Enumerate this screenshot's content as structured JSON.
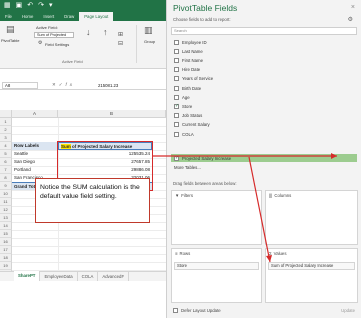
{
  "ribbon": {
    "tabs": [
      "File",
      "Home",
      "Insert",
      "Draw",
      "Page Layout"
    ],
    "active_tab": "Page Layout",
    "active_field_label": "Active Field:",
    "active_field_value": "Sum of Projected",
    "field_settings": "Field Settings",
    "pivottable_label": "PivotTable",
    "group_label": "Active Field",
    "group_btn": "Group"
  },
  "formula_bar": {
    "name_box": "A8",
    "fx": "fx",
    "value": "215081.23"
  },
  "grid": {
    "col_headers": [
      "A",
      "B"
    ],
    "row_numbers": [
      "1",
      "2",
      "3",
      "4",
      "5",
      "6",
      "7",
      "8",
      "9",
      "10",
      "11",
      "12",
      "13",
      "14",
      "15",
      "16",
      "17",
      "18",
      "19",
      "20",
      "21",
      "22",
      "23"
    ],
    "pivot": {
      "row_labels_header": "Row Labels",
      "value_header_sum": "Sum",
      "value_header_rest": " of Projected Salary Increase",
      "rows": [
        {
          "label": "Seattle",
          "value": "125535.24"
        },
        {
          "label": "San Diego",
          "value": "27657.85"
        },
        {
          "label": "Portland",
          "value": "29886.08"
        },
        {
          "label": "San Francisco",
          "value": "32031.06"
        }
      ],
      "grand_total_label": "Grand Total",
      "grand_total_value": "215081.23"
    }
  },
  "note": "Notice the SUM calculation is the default value field setting.",
  "sheet_tabs": [
    "SharePT",
    "EmployeeData",
    "COLA",
    "AdvancedF"
  ],
  "pane": {
    "title": "PivotTable Fields",
    "close": "×",
    "subtitle": "Choose fields to add to report:",
    "search_placeholder": "Search",
    "fields": [
      {
        "name": "Employee ID",
        "checked": false
      },
      {
        "name": "Last Name",
        "checked": false
      },
      {
        "name": "First Name",
        "checked": false
      },
      {
        "name": "Hire Date",
        "checked": false
      },
      {
        "name": "Years of Service",
        "checked": false
      },
      {
        "name": "Birth Date",
        "checked": false
      },
      {
        "name": "Age",
        "checked": false
      },
      {
        "name": "Store",
        "checked": true
      },
      {
        "name": "Job Status",
        "checked": false
      },
      {
        "name": "Current Salary",
        "checked": false
      },
      {
        "name": "COLA",
        "checked": false
      },
      {
        "name": "Projected Salary Increase",
        "checked": true
      }
    ],
    "more_tables": "More Tables...",
    "drag_label": "Drag fields between areas below:",
    "areas": {
      "filters": "Filters",
      "columns": "Columns",
      "rows": "Rows",
      "values": "Values"
    },
    "rows_pill": "Store",
    "values_pill": "Sum of Projected Salary Increase",
    "defer": "Defer Layout Update",
    "update": "Update"
  },
  "colors": {
    "accent": "#217346",
    "highlight_field": "#9ccc8f",
    "sum_highlight": "#ffe600",
    "annotation": "#d62a2a"
  }
}
